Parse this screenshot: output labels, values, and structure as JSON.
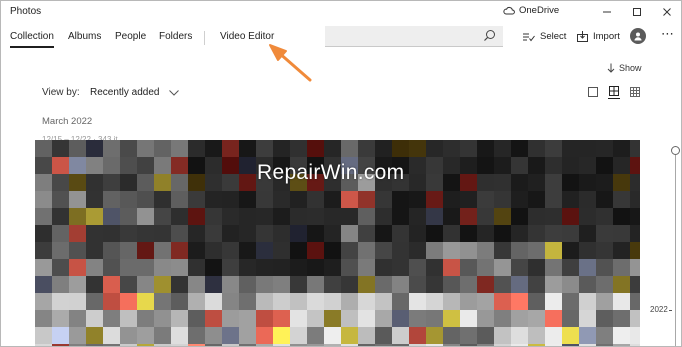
{
  "app": {
    "title": "Photos"
  },
  "titlebar": {
    "onedrive_label": "OneDrive"
  },
  "nav": {
    "tabs": [
      {
        "label": "Collection"
      },
      {
        "label": "Albums"
      },
      {
        "label": "People"
      },
      {
        "label": "Folders"
      },
      {
        "label": "Video Editor"
      }
    ]
  },
  "search": {
    "placeholder": ""
  },
  "toolbar": {
    "select_label": "Select",
    "import_label": "Import"
  },
  "view": {
    "show_label": "Show",
    "viewby_label": "View by:",
    "viewby_value": "Recently added"
  },
  "gallery": {
    "month": "March 2022",
    "sub": "12/15 – 12/22 · 343 it"
  },
  "timeline": {
    "year": "2022"
  },
  "watermark": {
    "text": "RepairWin.com"
  },
  "colors": {
    "arrow": "#f08a3a",
    "accent": "#1f1f1f"
  },
  "icons": [
    "onedrive-cloud-icon",
    "minimize-icon",
    "maximize-icon",
    "close-icon",
    "search-icon",
    "select-checklist-icon",
    "import-icon",
    "avatar-icon",
    "more-icon",
    "show-arrow-icon",
    "chevron-down-icon",
    "single-view-icon",
    "medium-grid-icon",
    "small-grid-icon"
  ]
}
